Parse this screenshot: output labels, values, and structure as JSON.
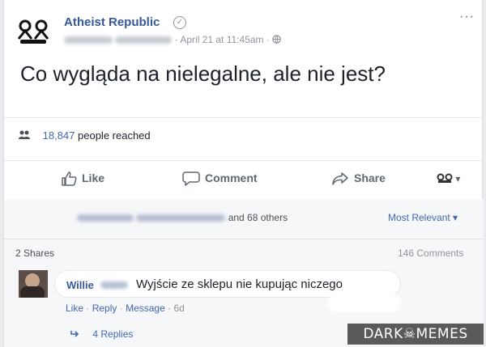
{
  "post": {
    "page_name": "Atheist Republic",
    "timestamp": "April 21 at 11:45am",
    "separator": "·",
    "text": "Co wygląda na nielegalne, ale nie jest?",
    "more_menu": "···"
  },
  "reach": {
    "count": "18,847",
    "label": "people reached"
  },
  "actions": {
    "like": "Like",
    "comment": "Comment",
    "share": "Share"
  },
  "engagement": {
    "others": "and 68 others",
    "sort": "Most Relevant",
    "shares": "2 Shares",
    "comments": "146 Comments"
  },
  "comment": {
    "author": "Willie",
    "text": "Wyjście ze sklepu nie kupując niczego",
    "actions": [
      "Like",
      "Reply",
      "Message"
    ],
    "age": "6d",
    "replies": "4 Replies"
  },
  "watermark": {
    "text": "DARK☠MEMES"
  },
  "colors": {
    "link": "#365899",
    "accent": "#4267b2",
    "muted": "#90949c",
    "watermark_bg": "#5a5a5a"
  },
  "icons": {
    "verified": "check-circle-icon",
    "globe": "globe-icon",
    "reach": "people-icon",
    "like": "thumbs-up-icon",
    "comment": "speech-bubble-icon",
    "share": "share-arrow-icon",
    "dropdown": "chevron-down-icon",
    "reply": "reply-arrow-icon"
  }
}
